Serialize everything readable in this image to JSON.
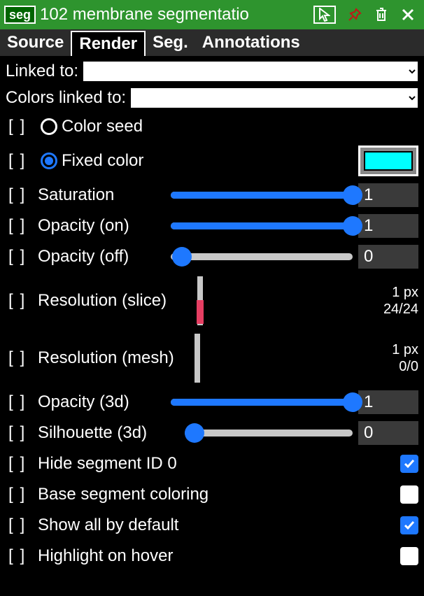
{
  "title": {
    "badge": "seg",
    "text": "102 membrane segmentatio"
  },
  "tabs": [
    "Source",
    "Render",
    "Seg.",
    "Annotations"
  ],
  "active_tab": 1,
  "linked_to": {
    "label": "Linked to:"
  },
  "colors_linked_to": {
    "label": "Colors linked to:"
  },
  "color_seed": {
    "label": "Color seed"
  },
  "fixed_color": {
    "label": "Fixed color",
    "color": "#00ffff"
  },
  "saturation": {
    "label": "Saturation",
    "value": "1",
    "pct": 100
  },
  "opacity_on": {
    "label": "Opacity (on)",
    "value": "1",
    "pct": 100
  },
  "opacity_off": {
    "label": "Opacity (off)",
    "value": "0",
    "pct": 0
  },
  "res_slice": {
    "label": "Resolution (slice)",
    "line1": "1 px",
    "line2": "24/24"
  },
  "res_mesh": {
    "label": "Resolution (mesh)",
    "line1": "1 px",
    "line2": "0/0"
  },
  "opacity_3d": {
    "label": "Opacity (3d)",
    "value": "1",
    "pct": 100
  },
  "silhouette_3d": {
    "label": "Silhouette (3d)",
    "value": "0",
    "pct": 0
  },
  "hide_seg0": {
    "label": "Hide segment ID 0",
    "checked": true
  },
  "base_coloring": {
    "label": "Base segment coloring",
    "checked": false
  },
  "show_all": {
    "label": "Show all by default",
    "checked": true
  },
  "highlight_hover": {
    "label": "Highlight on hover",
    "checked": false
  }
}
